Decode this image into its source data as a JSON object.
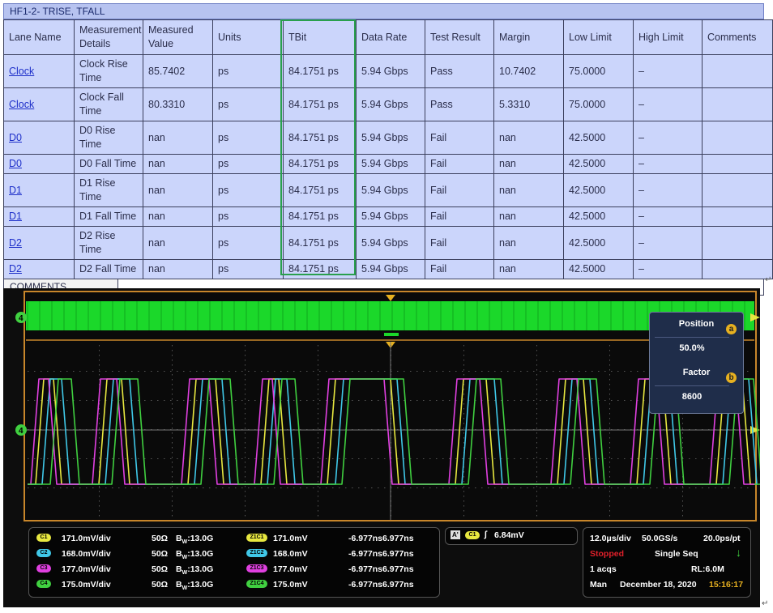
{
  "report": {
    "title": "HF1-2- TRISE, TFALL",
    "headers": [
      "Lane Name",
      "Measurement Details",
      "Measured Value",
      "Units",
      "TBit",
      "Data Rate",
      "Test Result",
      "Margin",
      "Low Limit",
      "High Limit",
      "Comments"
    ],
    "rows": [
      {
        "lane": "Clock",
        "detail": "Clock Rise Time",
        "value": "85.7402",
        "units": "ps",
        "tbit": "84.1751 ps",
        "rate": "5.94 Gbps",
        "result": "Pass",
        "margin": "10.7402",
        "low": "75.0000",
        "high": "–",
        "comments": ""
      },
      {
        "lane": "Clock",
        "detail": "Clock Fall Time",
        "value": "80.3310",
        "units": "ps",
        "tbit": "84.1751 ps",
        "rate": "5.94 Gbps",
        "result": "Pass",
        "margin": "5.3310",
        "low": "75.0000",
        "high": "–",
        "comments": ""
      },
      {
        "lane": "D0",
        "detail": "D0 Rise Time",
        "value": "nan",
        "units": "ps",
        "tbit": "84.1751 ps",
        "rate": "5.94 Gbps",
        "result": "Fail",
        "margin": "nan",
        "low": "42.5000",
        "high": "–",
        "comments": ""
      },
      {
        "lane": "D0",
        "detail": "D0 Fall Time",
        "value": "nan",
        "units": "ps",
        "tbit": "84.1751 ps",
        "rate": "5.94 Gbps",
        "result": "Fail",
        "margin": "nan",
        "low": "42.5000",
        "high": "–",
        "comments": ""
      },
      {
        "lane": "D1",
        "detail": "D1 Rise Time",
        "value": "nan",
        "units": "ps",
        "tbit": "84.1751 ps",
        "rate": "5.94 Gbps",
        "result": "Fail",
        "margin": "nan",
        "low": "42.5000",
        "high": "–",
        "comments": ""
      },
      {
        "lane": "D1",
        "detail": "D1 Fall Time",
        "value": "nan",
        "units": "ps",
        "tbit": "84.1751 ps",
        "rate": "5.94 Gbps",
        "result": "Fail",
        "margin": "nan",
        "low": "42.5000",
        "high": "–",
        "comments": ""
      },
      {
        "lane": "D2",
        "detail": "D2 Rise Time",
        "value": "nan",
        "units": "ps",
        "tbit": "84.1751 ps",
        "rate": "5.94 Gbps",
        "result": "Fail",
        "margin": "nan",
        "low": "42.5000",
        "high": "–",
        "comments": ""
      },
      {
        "lane": "D2",
        "detail": "D2 Fall Time",
        "value": "nan",
        "units": "ps",
        "tbit": "84.1751 ps",
        "rate": "5.94 Gbps",
        "result": "Fail",
        "margin": "nan",
        "low": "42.5000",
        "high": "–",
        "comments": ""
      }
    ],
    "comments_label": "COMMENTS",
    "colors": {
      "pass": "#1d8a2a",
      "fail": "#e0202a",
      "highlight": "#29a04d",
      "table_bg": "#cbd5fb"
    }
  },
  "scope": {
    "marker_label": "4",
    "popup": {
      "position_label": "Position",
      "position_value": "50.0%",
      "factor_label": "Factor",
      "factor_value": "8600",
      "badge_a": "a",
      "badge_b": "b"
    },
    "channels": [
      {
        "pill": "C1",
        "scale": "171.0mV/div",
        "imp": "50Ω",
        "bw": "B",
        "bwsub": "W",
        "bwval": ":13.0G",
        "zpill": "Z1C1",
        "zval": "171.0mV",
        "range": "-6.977ns6.977ns",
        "color": "#e8e840"
      },
      {
        "pill": "C2",
        "scale": "168.0mV/div",
        "imp": "50Ω",
        "bw": "B",
        "bwsub": "W",
        "bwval": ":13.0G",
        "zpill": "Z1C2",
        "zval": "168.0mV",
        "range": "-6.977ns6.977ns",
        "color": "#40c8e8"
      },
      {
        "pill": "C3",
        "scale": "177.0mV/div",
        "imp": "50Ω",
        "bw": "B",
        "bwsub": "W",
        "bwval": ":13.0G",
        "zpill": "Z1C3",
        "zval": "177.0mV",
        "range": "-6.977ns6.977ns",
        "color": "#e040e0"
      },
      {
        "pill": "C4",
        "scale": "175.0mV/div",
        "imp": "50Ω",
        "bw": "B",
        "bwsub": "W",
        "bwval": ":13.0G",
        "zpill": "Z1C4",
        "zval": "175.0mV",
        "range": "-6.977ns6.977ns",
        "color": "#40d040"
      }
    ],
    "trigger": {
      "a_label": "A'",
      "ch_pill": "C1",
      "symbol": "∫",
      "level": "6.84mV"
    },
    "acquisition": {
      "timebase": "12.0μs/div",
      "sample_rate": "50.0GS/s",
      "resolution": "20.0ps/pt",
      "state": "Stopped",
      "mode": "Single Seq",
      "acqs": "1 acqs",
      "record": "RL:6.0M",
      "trig_mode": "Man",
      "date": "December 18, 2020",
      "time": "15:16:17"
    },
    "colors": {
      "ch1": "#e8e840",
      "ch2": "#40c8e8",
      "ch3": "#e040e0",
      "ch4": "#40d040",
      "stopped": "#e0202a",
      "time": "#e6b020",
      "frame": "#c8862a"
    }
  }
}
